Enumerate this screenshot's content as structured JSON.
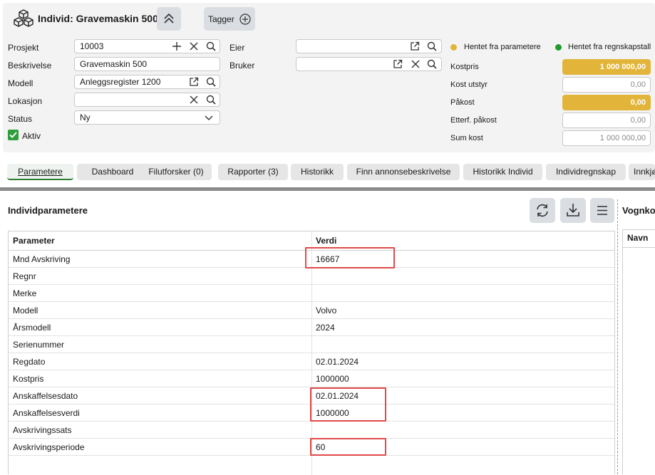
{
  "header": {
    "title": "Individ: Gravemaskin 500",
    "tags_label": "Tagger"
  },
  "form": {
    "prosjekt": {
      "label": "Prosjekt",
      "value": "10003"
    },
    "beskrivelse": {
      "label": "Beskrivelse",
      "value": "Gravemaskin 500"
    },
    "modell": {
      "label": "Modell",
      "value": "Anleggsregister 1200"
    },
    "lokasjon": {
      "label": "Lokasjon",
      "value": ""
    },
    "status": {
      "label": "Status",
      "value": "Ny"
    },
    "aktiv": {
      "label": "Aktiv",
      "checked": true
    },
    "eier": {
      "label": "Eier",
      "value": ""
    },
    "bruker": {
      "label": "Bruker",
      "value": ""
    }
  },
  "legend": {
    "param": {
      "label": "Hentet fra parametere",
      "color": "#e2b53a"
    },
    "regnskap": {
      "label": "Hentet fra regnskapstall",
      "color": "#1e9a2e"
    }
  },
  "costs": [
    {
      "label": "Kostpris",
      "value": "1 000 000,00",
      "highlight": true
    },
    {
      "label": "Kost utstyr",
      "value": "0,00",
      "highlight": false
    },
    {
      "label": "Påkost",
      "value": "0,00",
      "highlight": true
    },
    {
      "label": "Etterf. påkost",
      "value": "0,00",
      "highlight": false
    },
    {
      "label": "Sum kost",
      "value": "1 000 000,00",
      "highlight": false
    }
  ],
  "tabs": [
    {
      "label": "Parametere",
      "active": true
    },
    {
      "label": "Dashboard"
    },
    {
      "label": "Filutforsker (0)"
    },
    {
      "label": "Rapporter (3)"
    },
    {
      "label": "Historikk"
    },
    {
      "label": "Finn annonsebeskrivelse"
    },
    {
      "label": "Historikk Individ"
    },
    {
      "label": "Individregnskap"
    },
    {
      "label": "Innkjø"
    }
  ],
  "params": {
    "title": "Individparametere",
    "col_param": "Parameter",
    "col_value": "Verdi",
    "rows": [
      {
        "param": "Mnd Avskriving",
        "value": "16667"
      },
      {
        "param": "Regnr",
        "value": ""
      },
      {
        "param": "Merke",
        "value": ""
      },
      {
        "param": "Modell",
        "value": "Volvo"
      },
      {
        "param": "Årsmodell",
        "value": "2024"
      },
      {
        "param": "Serienummer",
        "value": ""
      },
      {
        "param": "Regdato",
        "value": "02.01.2024"
      },
      {
        "param": "Kostpris",
        "value": "1000000"
      },
      {
        "param": "Anskaffelsesdato",
        "value": "02.01.2024"
      },
      {
        "param": "Anskaffelsesverdi",
        "value": "1000000"
      },
      {
        "param": "Avskrivingssats",
        "value": ""
      },
      {
        "param": "Avskrivingsperiode",
        "value": "60"
      }
    ]
  },
  "right_panel": {
    "title": "Vognko",
    "col": "Navn"
  }
}
